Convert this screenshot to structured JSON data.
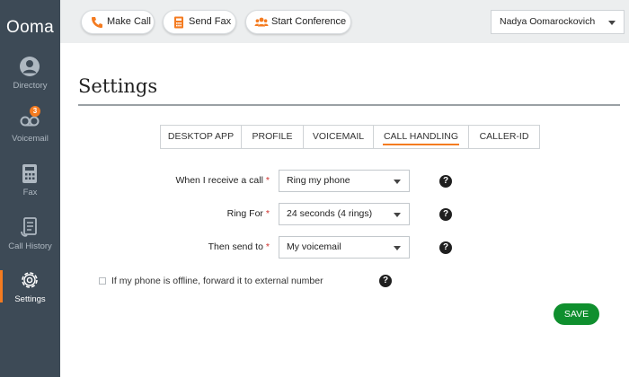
{
  "app": {
    "logo": "Ooma"
  },
  "sidebar": {
    "items": [
      {
        "label": "Directory",
        "icon": "person-icon"
      },
      {
        "label": "Voicemail",
        "icon": "voicemail-icon",
        "badge": "3"
      },
      {
        "label": "Fax",
        "icon": "fax-icon"
      },
      {
        "label": "Call History",
        "icon": "call-history-icon"
      },
      {
        "label": "Settings",
        "icon": "gear-icon",
        "active": true
      }
    ]
  },
  "topbar": {
    "make_call": "Make Call",
    "send_fax": "Send Fax",
    "start_conference": "Start Conference",
    "user_name": "Nadya Oomarockovich"
  },
  "page": {
    "title": "Settings"
  },
  "tabs": [
    {
      "label": "DESKTOP APP"
    },
    {
      "label": "PROFILE"
    },
    {
      "label": "VOICEMAIL"
    },
    {
      "label": "CALL HANDLING",
      "active": true
    },
    {
      "label": "CALLER-ID"
    }
  ],
  "form": {
    "fields": [
      {
        "label": "When I receive a call",
        "required": "*",
        "value": "Ring my phone"
      },
      {
        "label": "Ring For",
        "required": "*",
        "value": "24 seconds (4 rings)"
      },
      {
        "label": "Then send to",
        "required": "*",
        "value": "My voicemail"
      }
    ],
    "help_glyph": "?",
    "offline_forward_label": "If my phone is offline, forward it to external number",
    "offline_forward_checked": false,
    "save_label": "SAVE"
  },
  "colors": {
    "accent": "#f47b20",
    "sidebar": "#3d4a56",
    "save": "#0f8f2e"
  }
}
